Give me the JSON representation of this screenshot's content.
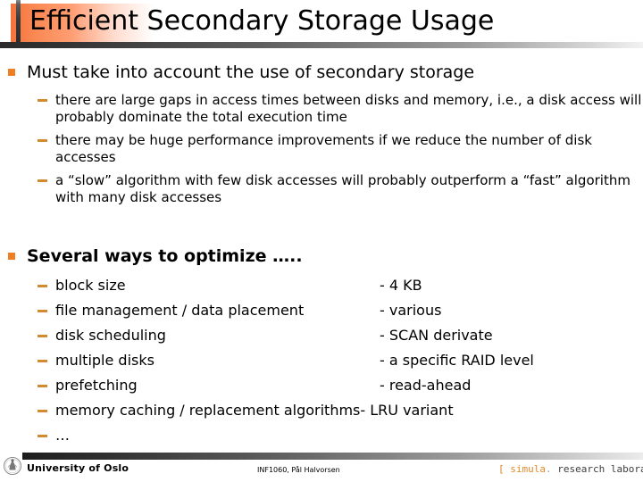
{
  "title": "Efficient Secondary Storage Usage",
  "colors": {
    "bullet_square": "#ef7d22",
    "bullet_dash": "#d4892f",
    "title_swatch": "#f4733c",
    "simula_orange": "#e08a2e"
  },
  "sections": [
    {
      "heading": "Must take into account the use of secondary storage",
      "bold": false,
      "sub_items": [
        "there are large gaps in access times between disks and memory, i.e., a disk access will probably dominate the total execution time",
        "there may be huge performance improvements if we reduce the number of disk accesses",
        "a “slow” algorithm with few disk accesses will probably outperform a “fast” algorithm with many disk accesses"
      ]
    }
  ],
  "optimize": {
    "heading": "Several ways to optimize …..",
    "rows": [
      {
        "key": "block size",
        "value": "- 4 KB"
      },
      {
        "key": "file management / data placement",
        "value": "- various"
      },
      {
        "key": "disk scheduling",
        "value": "- SCAN derivate"
      },
      {
        "key": "multiple disks",
        "value": "- a specific RAID level"
      },
      {
        "key": "prefetching",
        "value": "- read-ahead"
      },
      {
        "key": "memory caching / replacement algorithms",
        "value": "- LRU variant",
        "inline": true
      },
      {
        "key": "…",
        "value": ""
      }
    ]
  },
  "footer": {
    "university": "University of Oslo",
    "course": "INF1060, Pål Halvorsen",
    "simula": {
      "open_bracket": "[",
      "name": "simula",
      "dot": ".",
      "rest": "research laboratory",
      "close_bracket": "]"
    }
  }
}
